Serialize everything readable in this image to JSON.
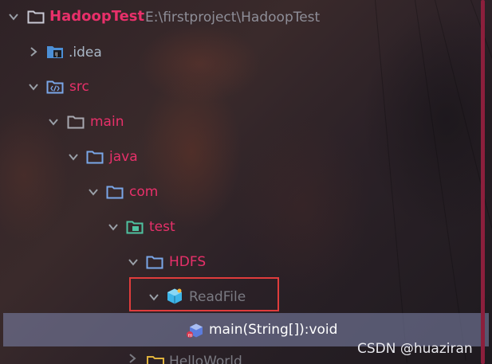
{
  "tree": {
    "project": {
      "name": "HadoopTest",
      "path": "E:\\firstproject\\HadoopTest"
    },
    "idea": ".idea",
    "src": "src",
    "main": "main",
    "java": "java",
    "com": "com",
    "test": "test",
    "hdfs": "HDFS",
    "readfile": "ReadFile",
    "method": "main(String[]):void",
    "partial": "HelloWorld"
  },
  "watermark": "CSDN @huaziran",
  "colors": {
    "label_accent": "#e8306a",
    "folder_blue": "#7aa7e8",
    "selection": "#787da0",
    "highlight_box": "#e03c3c",
    "scrollbar": "#8c1f3c"
  },
  "icons": {
    "project_folder": "folder-icon",
    "idea_folder": "idea-folder-icon",
    "src_folder": "source-folder-icon",
    "package_folder": "folder-icon",
    "test_package": "test-package-icon",
    "class": "java-class-icon",
    "method": "method-icon",
    "expanded": "chevron-down-icon",
    "collapsed": "chevron-right-icon"
  }
}
